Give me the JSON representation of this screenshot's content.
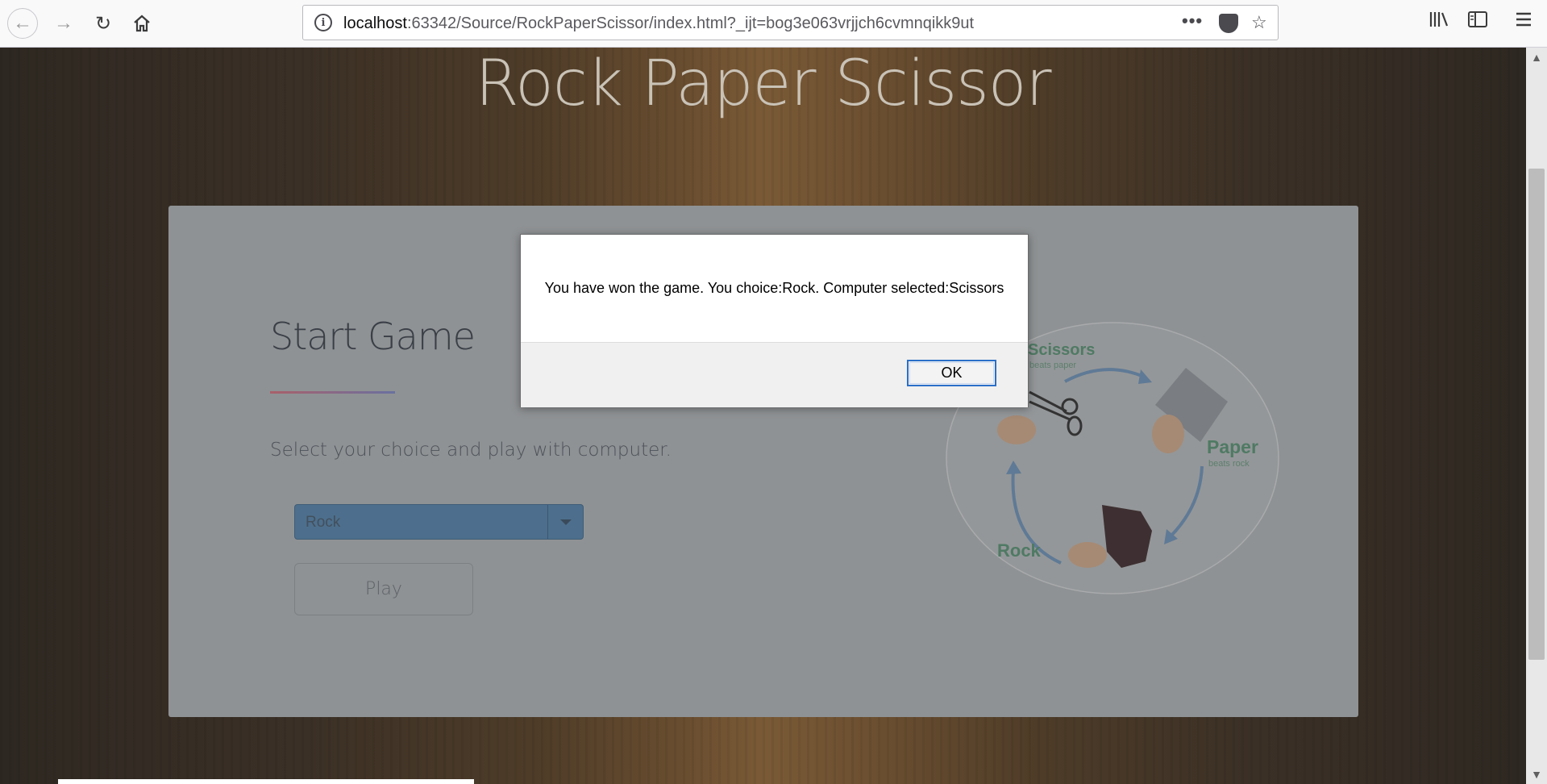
{
  "browser": {
    "url_host": "localhost",
    "url_path": ":63342/Source/RockPaperScissor/index.html?_ijt=bog3e063vrjjch6cvmnqikk9ut",
    "menu_dots": "•••"
  },
  "page": {
    "site_title": "Rock Paper Scissor",
    "start_title": "Start Game",
    "subtitle": "Select your choice and play with computer.",
    "select_value": "Rock",
    "play_label": "Play",
    "diagram": {
      "scissors_label": "Scissors",
      "scissors_sub": "beats paper",
      "paper_label": "Paper",
      "paper_sub": "beats rock",
      "rock_label": "Rock"
    }
  },
  "dialog": {
    "message": "You have won the game. You choice:Rock. Computer selected:Scissors",
    "ok_label": "OK"
  },
  "colors": {
    "accent_blue": "#2a6fc8",
    "card_overlay": "#8f9294",
    "select_blue": "#4d6f8d"
  }
}
